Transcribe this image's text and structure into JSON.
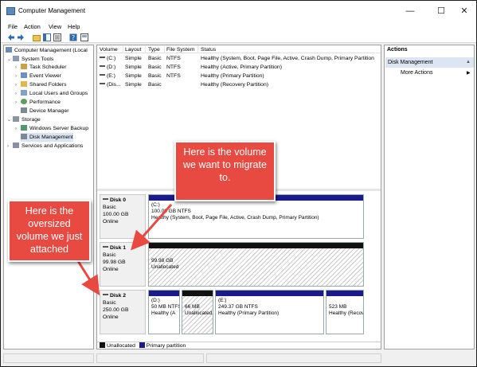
{
  "window": {
    "title": "Computer Management",
    "minimize_glyph": "—",
    "maximize_glyph": "☐",
    "close_glyph": "✕"
  },
  "menu": [
    "File",
    "Action",
    "View",
    "Help"
  ],
  "toolbar": {
    "icons": [
      "back-arrow-icon",
      "forward-arrow-icon",
      "up-folder-icon",
      "console-tree-icon",
      "properties-icon",
      "help-icon",
      "show-hide-icon"
    ]
  },
  "tree": {
    "root": "Computer Management (Local",
    "system_tools": "System Tools",
    "task_scheduler": "Task Scheduler",
    "event_viewer": "Event Viewer",
    "shared_folders": "Shared Folders",
    "local_users": "Local Users and Groups",
    "performance": "Performance",
    "device_manager": "Device Manager",
    "storage": "Storage",
    "windows_server_backup": "Windows Server Backup",
    "disk_management": "Disk Management",
    "services": "Services and Applications"
  },
  "volume_table": {
    "headers": [
      "Volume",
      "Layout",
      "Type",
      "File System",
      "Status"
    ],
    "rows": [
      [
        "(C:)",
        "Simple",
        "Basic",
        "NTFS",
        "Healthy (System, Boot, Page File, Active, Crash Dump, Primary Partition"
      ],
      [
        "(D:)",
        "Simple",
        "Basic",
        "NTFS",
        "Healthy (Active, Primary Partition)"
      ],
      [
        "(E:)",
        "Simple",
        "Basic",
        "NTFS",
        "Healthy (Primary Partition)"
      ],
      [
        "(Dis...",
        "Simple",
        "Basic",
        "",
        "Healthy (Recovery Partition)"
      ]
    ]
  },
  "disks": [
    {
      "name": "Disk 0",
      "type": "Basic",
      "size": "100.00 GB",
      "state": "Online",
      "partitions": [
        {
          "label": "(C:)",
          "size": "100.00 GB NTFS",
          "status": "Healthy (System, Boot, Page File, Active, Crash Dump, Primary Partition)"
        }
      ]
    },
    {
      "name": "Disk 1",
      "type": "Basic",
      "size": "99.98 GB",
      "state": "Online",
      "partitions": [
        {
          "label": "",
          "size": "99.98 GB",
          "status": "Unallocated"
        }
      ]
    },
    {
      "name": "Disk 2",
      "type": "Basic",
      "size": "250.00 GB",
      "state": "Online",
      "partitions": [
        {
          "label": "(D:)",
          "size": "50 MB NTFS",
          "status": "Healthy (A"
        },
        {
          "label": "",
          "size": "66 MB",
          "status": "Unallocated"
        },
        {
          "label": "(E:)",
          "size": "249.37 GB NTFS",
          "status": "Healthy (Primary Partition)"
        },
        {
          "label": "",
          "size": "523 MB",
          "status": "Healthy (Recovery"
        }
      ]
    }
  ],
  "legend": {
    "unallocated": "Unallocated",
    "primary": "Primary partition",
    "unallocated_color": "#111111",
    "primary_color": "#1a1a8c"
  },
  "actions": {
    "title": "Actions",
    "section": "Disk Management",
    "more": "More Actions",
    "more_arrow": "▶",
    "collapse_arrow": "▲"
  },
  "callouts": {
    "migrate_target": "Here is the volume we want to migrate to.",
    "oversized": "Here is the oversized volume we just attached",
    "color": "#e84a41"
  }
}
